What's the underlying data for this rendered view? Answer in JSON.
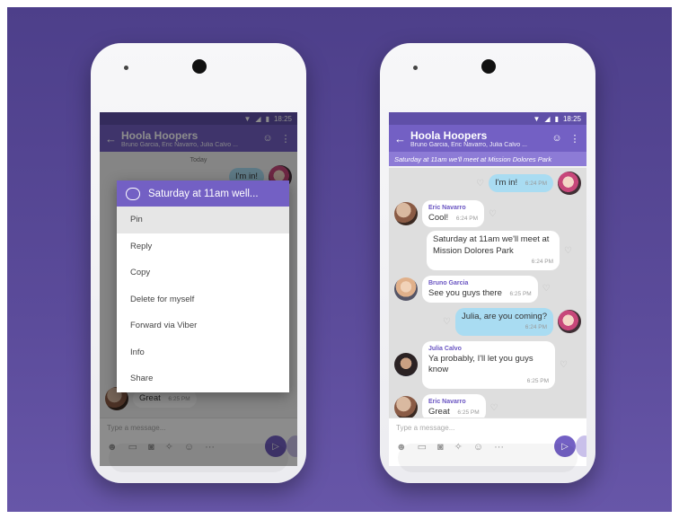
{
  "left_phone": {
    "status": {
      "time": "18:25"
    },
    "appbar": {
      "title": "Hoola Hoopers",
      "subtitle": "Bruno Garcia, Eric Navarro, Julia Calvo ..."
    },
    "background": {
      "date_divider": "Today",
      "visible_message": "I'm in!",
      "last_message": "Great",
      "last_time": "6:25 PM"
    },
    "context_menu": {
      "header": "Saturday at 11am well...",
      "items": [
        "Pin",
        "Reply",
        "Copy",
        "Delete for myself",
        "Forward via Viber",
        "Info",
        "Share"
      ]
    },
    "composer": {
      "placeholder": "Type a message..."
    }
  },
  "right_phone": {
    "status": {
      "time": "18:25"
    },
    "appbar": {
      "title": "Hoola Hoopers",
      "subtitle": "Bruno Garcia, Eric Navarro, Julia Calvo ..."
    },
    "pinned": "Saturday at 11am we'll meet at Mission Dolores Park",
    "messages": [
      {
        "direction": "out",
        "text": "I'm in!",
        "time": "6:24 PM"
      },
      {
        "direction": "in",
        "sender": "Eric Navarro",
        "text": "Cool!",
        "time": "6:24 PM"
      },
      {
        "direction": "in",
        "text": "Saturday at 11am we'll meet at Mission Dolores Park",
        "time": "6:24 PM"
      },
      {
        "direction": "in",
        "sender": "Bruno Garcia",
        "text": "See you guys there",
        "time": "6:25 PM"
      },
      {
        "direction": "out",
        "text": "Julia, are you coming?",
        "time": "6:24 PM"
      },
      {
        "direction": "in",
        "sender": "Julia Calvo",
        "text": "Ya probably, I'll let you guys know",
        "time": "6:25 PM"
      },
      {
        "direction": "in",
        "sender": "Eric Navarro",
        "text": "Great",
        "time": "6:25 PM"
      }
    ],
    "composer": {
      "placeholder": "Type a message..."
    }
  },
  "icons": {
    "back": "arrow-left-icon",
    "add_participant": "add-person-icon",
    "more": "more-vertical-icon",
    "sticker": "sticker-icon",
    "gif": "gif-icon",
    "camera": "camera-icon",
    "doodle": "doodle-icon",
    "emoticon": "emoticon-icon",
    "more_options": "ellipsis-icon",
    "send": "viber-send-icon",
    "like": "heart-icon"
  },
  "colors": {
    "accent": "#7360c4",
    "statusbar": "#5f4fa8",
    "pinned_bar": "#8d7bd6",
    "outgoing_bubble": "#a9dcf2",
    "background": "#564697"
  }
}
